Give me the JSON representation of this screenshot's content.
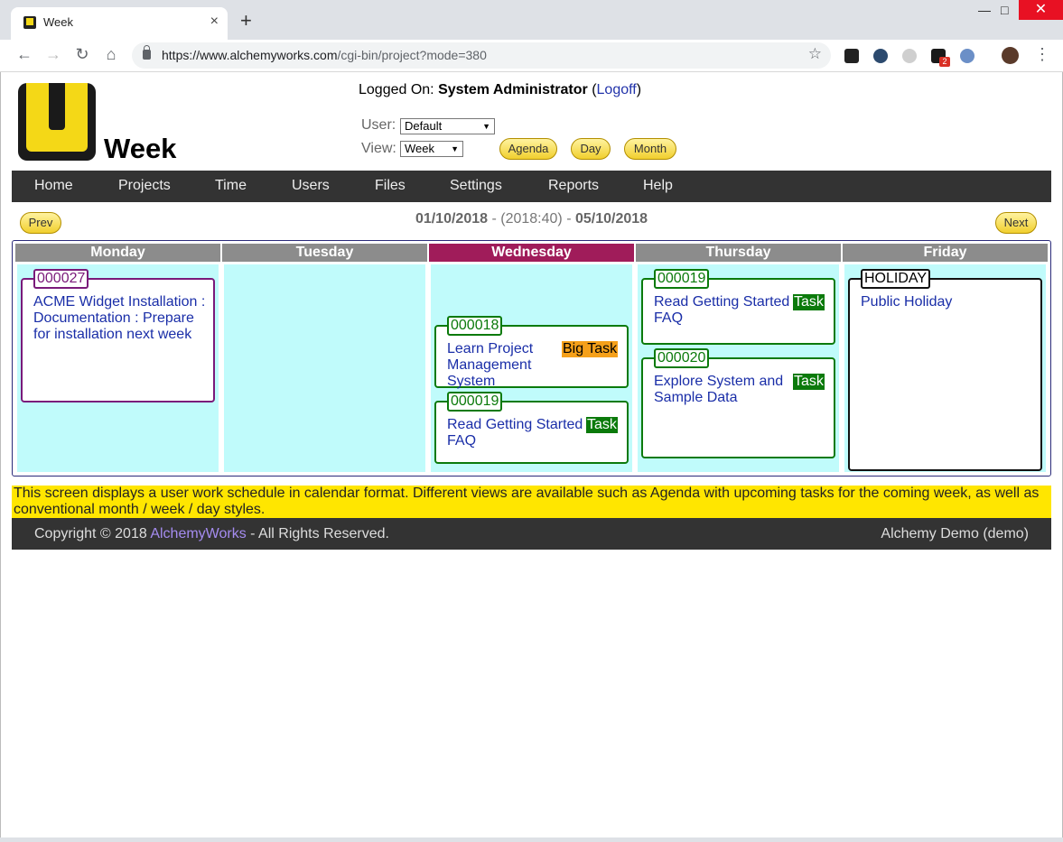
{
  "browser": {
    "tab_title": "Week",
    "tab_close": "×",
    "new_tab": "+",
    "url_host": "https://www.alchemyworks.com",
    "url_path": "/cgi-bin/project?mode=380",
    "ext_badge": "2"
  },
  "app": {
    "title": "Week"
  },
  "session": {
    "logged_on_label": "Logged On:",
    "user_name": "System Administrator",
    "logoff_label": "Logoff"
  },
  "filters": {
    "user_label": "User:",
    "user_value": "Default",
    "view_label": "View:",
    "view_value": "Week"
  },
  "view_buttons": {
    "agenda": "Agenda",
    "day": "Day",
    "month": "Month"
  },
  "nav": {
    "items": [
      "Home",
      "Projects",
      "Time",
      "Users",
      "Files",
      "Settings",
      "Reports",
      "Help"
    ]
  },
  "pager": {
    "prev": "Prev",
    "next": "Next",
    "start_date": "01/10/2018",
    "week": "(2018:40)",
    "end_date": "05/10/2018",
    "sep": "-"
  },
  "days": [
    "Monday",
    "Tuesday",
    "Wednesday",
    "Thursday",
    "Friday"
  ],
  "tasks": {
    "monday_1": {
      "id": "000027",
      "text": "ACME Widget Installation : Documentation : Prepare for installation next week"
    },
    "wednesday_1": {
      "id": "000018",
      "text": "Learn Project Management System",
      "tag": "Big Task"
    },
    "wednesday_2": {
      "id": "000019",
      "text": "Read Getting Started FAQ",
      "tag": "Task"
    },
    "thursday_1": {
      "id": "000019",
      "text": "Read Getting Started FAQ",
      "tag": "Task"
    },
    "thursday_2": {
      "id": "000020",
      "text": "Explore System and Sample Data",
      "tag": "Task"
    },
    "friday_1": {
      "id": "HOLIDAY",
      "text": "Public Holiday"
    }
  },
  "info": "This screen displays a user work schedule in calendar format. Different views are available such as Agenda with upcoming tasks for the coming week, as well as conventional month / week / day styles.",
  "footer": {
    "copyright": "Copyright © 2018",
    "company": "AlchemyWorks",
    "rights": "- All Rights Reserved.",
    "account": "Alchemy Demo (demo)"
  },
  "colors": {
    "nav_bg": "#333333",
    "today_header": "#a01c5a",
    "day_header": "#8c8c8c",
    "day_bg": "#c0fbfb",
    "task_border": "#0b7a0b",
    "info_bar": "#ffe600"
  }
}
